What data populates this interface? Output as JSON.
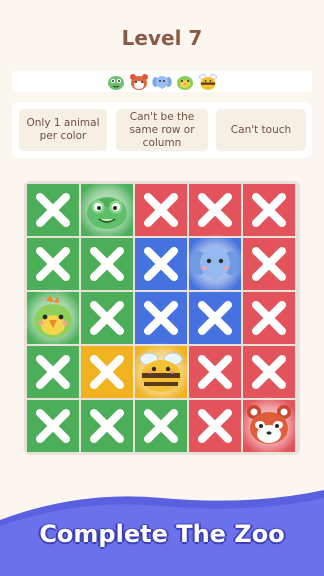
{
  "level_title": "Level 7",
  "animal_bar": {
    "animals": [
      "chameleon-icon",
      "red-panda-icon",
      "elephant-icon",
      "parrot-icon",
      "bee-icon"
    ]
  },
  "rules": [
    {
      "text": "Only 1 animal per color"
    },
    {
      "text": "Can't be the same row or column"
    },
    {
      "text": "Can't touch"
    }
  ],
  "colors": {
    "green": "#4cae59",
    "red": "#e2535b",
    "blue": "#4572de",
    "yellow": "#f0b21f"
  },
  "board": {
    "rows": [
      [
        "green",
        "green",
        "red",
        "red",
        "red"
      ],
      [
        "green",
        "green",
        "blue",
        "blue",
        "red"
      ],
      [
        "green",
        "green",
        "blue",
        "blue",
        "red"
      ],
      [
        "green",
        "yellow",
        "yellow",
        "red",
        "red"
      ],
      [
        "green",
        "green",
        "green",
        "red",
        "red"
      ]
    ],
    "cells": [
      [
        "x",
        "chameleon",
        "x",
        "x",
        "x"
      ],
      [
        "x",
        "x",
        "x",
        "elephant",
        "x"
      ],
      [
        "parrot",
        "x",
        "x",
        "x",
        "x"
      ],
      [
        "x",
        "x",
        "bee",
        "x",
        "x"
      ],
      [
        "x",
        "x",
        "x",
        "x",
        "red-panda"
      ]
    ]
  },
  "footer": {
    "text": "Complete The Zoo"
  }
}
